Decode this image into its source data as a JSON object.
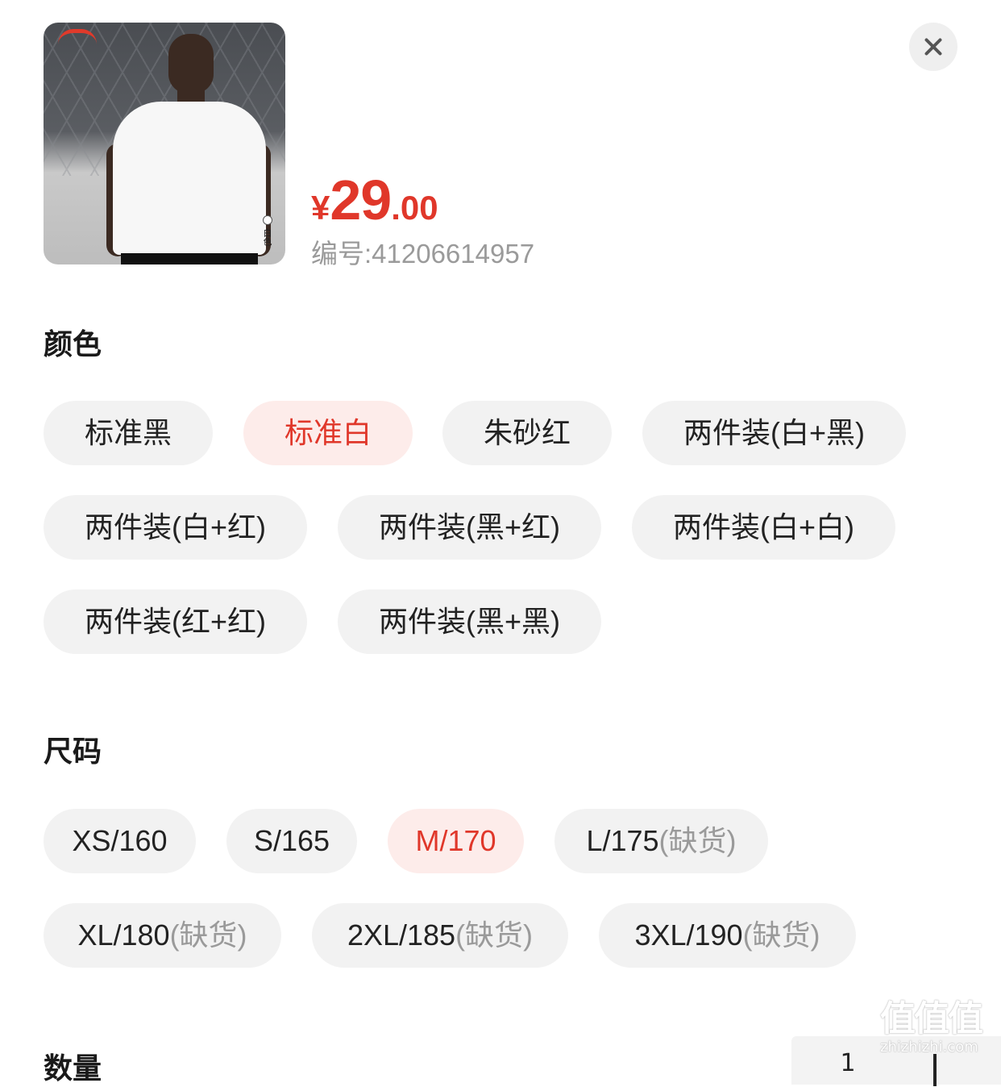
{
  "product": {
    "thumbnail_color_label": "白色",
    "brand_logo_text": "LI-NING",
    "price_currency": "¥",
    "price_integer": "29",
    "price_decimal": ".00",
    "sku_text": "编号:41206614957"
  },
  "close_icon": "close-icon",
  "color_section": {
    "title": "颜色",
    "options": [
      {
        "label": "标准黑",
        "selected": false
      },
      {
        "label": "标准白",
        "selected": true
      },
      {
        "label": "朱砂红",
        "selected": false
      },
      {
        "label": "两件装(白+黑)",
        "selected": false
      },
      {
        "label": "两件装(白+红)",
        "selected": false
      },
      {
        "label": "两件装(黑+红)",
        "selected": false
      },
      {
        "label": "两件装(白+白)",
        "selected": false
      },
      {
        "label": "两件装(红+红)",
        "selected": false
      },
      {
        "label": "两件装(黑+黑)",
        "selected": false
      }
    ]
  },
  "size_section": {
    "title": "尺码",
    "options": [
      {
        "label": "XS/160",
        "suffix": "",
        "selected": false
      },
      {
        "label": "S/165",
        "suffix": "",
        "selected": false
      },
      {
        "label": "M/170",
        "suffix": "",
        "selected": true
      },
      {
        "label": "L/175",
        "suffix": "(缺货)",
        "selected": false
      },
      {
        "label": "XL/180",
        "suffix": "(缺货)",
        "selected": false
      },
      {
        "label": "2XL/185",
        "suffix": "(缺货)",
        "selected": false
      },
      {
        "label": "3XL/190",
        "suffix": "(缺货)",
        "selected": false
      }
    ]
  },
  "quantity_section": {
    "title": "数量",
    "value": "1"
  },
  "watermark": {
    "big": "值值值",
    "small": "zhizhizhi.com"
  },
  "colors": {
    "accent": "#e0372a",
    "selected_bg": "#fdecea",
    "chip_bg": "#f2f2f2",
    "muted_text": "#9a9a9a"
  }
}
